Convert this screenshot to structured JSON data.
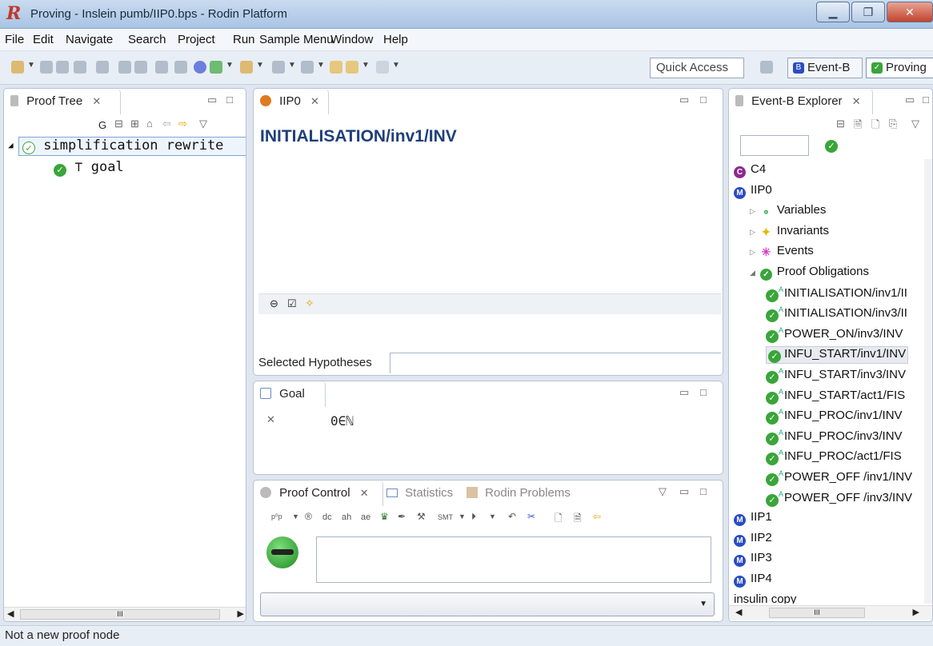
{
  "window": {
    "title": "Proving - Inslein pumb/IIP0.bps - Rodin Platform"
  },
  "menu": [
    "File",
    "Edit",
    "Navigate",
    "Search",
    "Project",
    "Run",
    "Sample Menu",
    "Window",
    "Help"
  ],
  "toolbar": {
    "quick_access": "Quick Access",
    "perspectives": [
      "Event-B",
      "Proving"
    ]
  },
  "proof_tree": {
    "tab": "Proof Tree",
    "toolbar_g": "G",
    "nodes": [
      {
        "label": "simplification rewrite",
        "status": "hollow-check"
      },
      {
        "label": "⊤ goal",
        "status": "check"
      }
    ]
  },
  "editor": {
    "tab": "IIP0",
    "heading": "INITIALISATION/inv1/INV",
    "selected_hypotheses": "Selected Hypotheses"
  },
  "goal": {
    "tab": "Goal",
    "text": "0∈ℕ"
  },
  "proof_control": {
    "tabs": [
      "Proof Control",
      "Statistics",
      "Rodin Problems"
    ],
    "buttons": [
      "p⁰p",
      "dc",
      "ah",
      "ae",
      "SMT"
    ]
  },
  "explorer": {
    "tab": "Event-B Explorer",
    "items": [
      {
        "label": "C4",
        "icon": "C",
        "color": "#8b2c8b",
        "indent": 0
      },
      {
        "label": "IIP0",
        "icon": "M",
        "color": "#2a4cc4",
        "indent": 0
      },
      {
        "label": "Variables",
        "icon": "∘",
        "color": "#2aa84a",
        "indent": 1,
        "expander": "▷"
      },
      {
        "label": "Invariants",
        "icon": "✦",
        "color": "#e5b800",
        "indent": 1,
        "expander": "▷"
      },
      {
        "label": "Events",
        "icon": "✳",
        "color": "#d93fc9",
        "indent": 1,
        "expander": "▷"
      },
      {
        "label": "Proof Obligations",
        "icon": "✓",
        "color": "#3aa53a",
        "indent": 1,
        "expander": "◢"
      },
      {
        "label": "INITIALISATION/inv1/II",
        "po": true,
        "auto": true
      },
      {
        "label": "INITIALISATION/inv3/II",
        "po": true,
        "auto": true
      },
      {
        "label": "POWER_ON/inv3/INV",
        "po": true,
        "auto": true
      },
      {
        "label": "INFU_START/inv1/INV",
        "po": true,
        "auto": false,
        "selected": true
      },
      {
        "label": "INFU_START/inv3/INV",
        "po": true,
        "auto": true
      },
      {
        "label": "INFU_START/act1/FIS",
        "po": true,
        "auto": true
      },
      {
        "label": "INFU_PROC/inv1/INV",
        "po": true,
        "auto": true
      },
      {
        "label": "INFU_PROC/inv3/INV",
        "po": true,
        "auto": true
      },
      {
        "label": "INFU_PROC/act1/FIS",
        "po": true,
        "auto": true
      },
      {
        "label": "POWER_OFF /inv1/INV",
        "po": true,
        "auto": true
      },
      {
        "label": "POWER_OFF /inv3/INV",
        "po": true,
        "auto": true
      },
      {
        "label": "IIP1",
        "icon": "M",
        "color": "#2a4cc4",
        "indent": 0
      },
      {
        "label": "IIP2",
        "icon": "M",
        "color": "#2a4cc4",
        "indent": 0
      },
      {
        "label": "IIP3",
        "icon": "M",
        "color": "#2a4cc4",
        "indent": 0
      },
      {
        "label": "IIP4",
        "icon": "M",
        "color": "#2a4cc4",
        "indent": 0
      },
      {
        "label": "insulin copy",
        "icon": "",
        "color": "",
        "indent": 0
      }
    ]
  },
  "status": {
    "text": "Not a new proof node"
  },
  "scroll_label": "III"
}
